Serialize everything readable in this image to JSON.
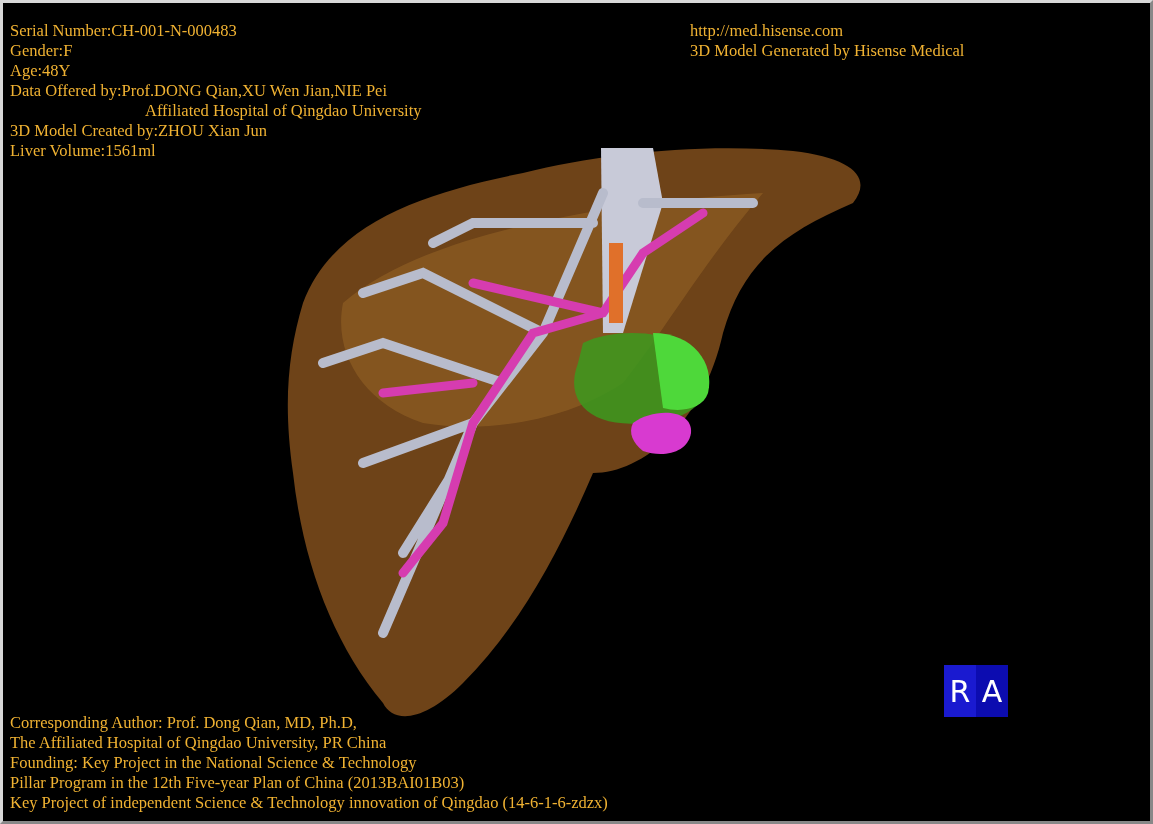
{
  "info_top_left": [
    {
      "text": "Serial Number:CH-001-N-000483",
      "kind": "line"
    },
    {
      "text": "Gender:F",
      "kind": "line"
    },
    {
      "text": "Age:48Y",
      "kind": "line"
    },
    {
      "text": "Data Offered by:Prof.DONG Qian,XU Wen Jian,NIE Pei",
      "kind": "line"
    },
    {
      "text": "Affiliated Hospital of Qingdao University",
      "kind": "continuation"
    },
    {
      "text": "3D Model Created by:ZHOU Xian Jun",
      "kind": "line"
    },
    {
      "text": "Liver Volume:1561ml",
      "kind": "line"
    }
  ],
  "info_top_right": [
    "http://med.hisense.com",
    "3D Model Generated by Hisense Medical"
  ],
  "info_bottom_left": [
    "Corresponding Author: Prof. Dong Qian, MD, Ph.D,",
    "The Affiliated Hospital of Qingdao University, PR China",
    "Founding: Key Project in the National Science & Technology",
    "Pillar Program in the 12th Five-year Plan of China (2013BAI01B03)",
    "Key Project of independent Science & Technology innovation of Qingdao (14-6-1-6-zdzx)"
  ],
  "orientation_cube": {
    "faces": [
      "R",
      "A"
    ]
  }
}
